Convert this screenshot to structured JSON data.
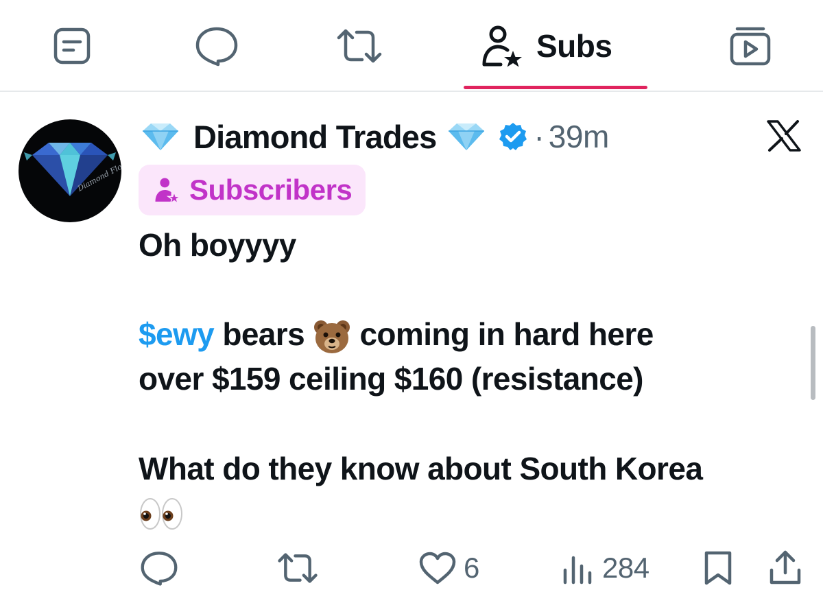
{
  "tabs": [
    {
      "icon": "posts-icon",
      "label": ""
    },
    {
      "icon": "replies-icon",
      "label": ""
    },
    {
      "icon": "reposts-icon",
      "label": ""
    },
    {
      "icon": "subscriptions-icon",
      "label": "Subs",
      "active": true
    },
    {
      "icon": "media-icon",
      "label": ""
    }
  ],
  "post": {
    "author": "Diamond Trades",
    "time": "39m",
    "separator": "·",
    "badge_label": "Subscribers",
    "avatar_text": "Diamond Flow & TA",
    "lines": {
      "l1": "Oh boyyyy",
      "cashtag": "$ewy",
      "l2_rest": " bears ",
      "l2_end": " coming in hard here",
      "l3": "over $159 ceiling $160 (resistance)",
      "l4": "What do they know about South Korea"
    },
    "emojis": [
      "bear-face-emoji",
      "eyes-emoji"
    ]
  },
  "actions": {
    "reply_count": "",
    "repost_count": "",
    "like_count": "6",
    "views_count": "284"
  },
  "colors": {
    "accent": "#e0245e",
    "link": "#1d9bf0",
    "badge_bg": "#fbe6fb",
    "badge_text": "#c133c8",
    "muted": "#536471"
  }
}
